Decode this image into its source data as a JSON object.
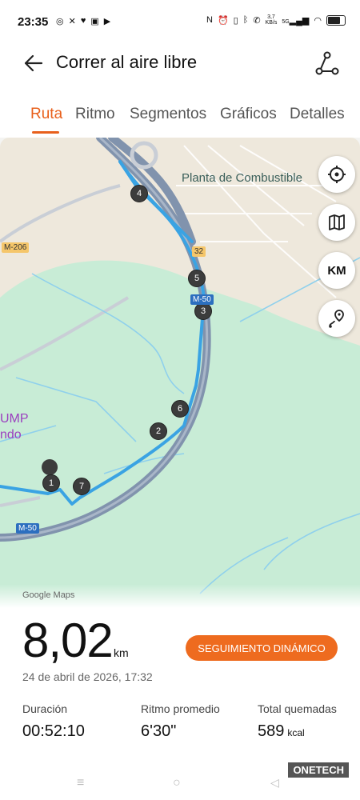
{
  "status_bar": {
    "time": "23:35",
    "speed_value": "3,7",
    "speed_unit": "KB/s",
    "network": "5G"
  },
  "header": {
    "title": "Correr al aire libre"
  },
  "tabs": [
    {
      "label": "Ruta",
      "active": true
    },
    {
      "label": "Ritmo"
    },
    {
      "label": "Segmentos"
    },
    {
      "label": "Gráficos"
    },
    {
      "label": "Detalles"
    }
  ],
  "map": {
    "place_label": "Planta de Combustible",
    "partial_label_1": "UMP",
    "partial_label_2": "ndo",
    "road_m206": "M-206",
    "road_m50_a": "M-50",
    "road_m50_b": "M-50",
    "road_32": "32",
    "markers": [
      "1",
      "2",
      "3",
      "4",
      "5",
      "6",
      "7"
    ],
    "buttons": {
      "km_label": "KM"
    },
    "attribution": "Google Maps"
  },
  "summary": {
    "distance": "8,02",
    "distance_unit": "km",
    "dynamic_button": "SEGUIMIENTO DINÁMICO",
    "date": "24 de abril de 2026, 17:32",
    "stats": [
      {
        "label": "Duración",
        "value": "00:52:10",
        "unit": ""
      },
      {
        "label": "Ritmo promedio",
        "value": "6'30\"",
        "unit": ""
      },
      {
        "label": "Total quemadas",
        "value": "589",
        "unit": "kcal"
      }
    ]
  },
  "watermark": "ONETECH",
  "colors": {
    "accent": "#e8601c",
    "route": "#3aa3e3",
    "highway": "#7d8fa8"
  }
}
